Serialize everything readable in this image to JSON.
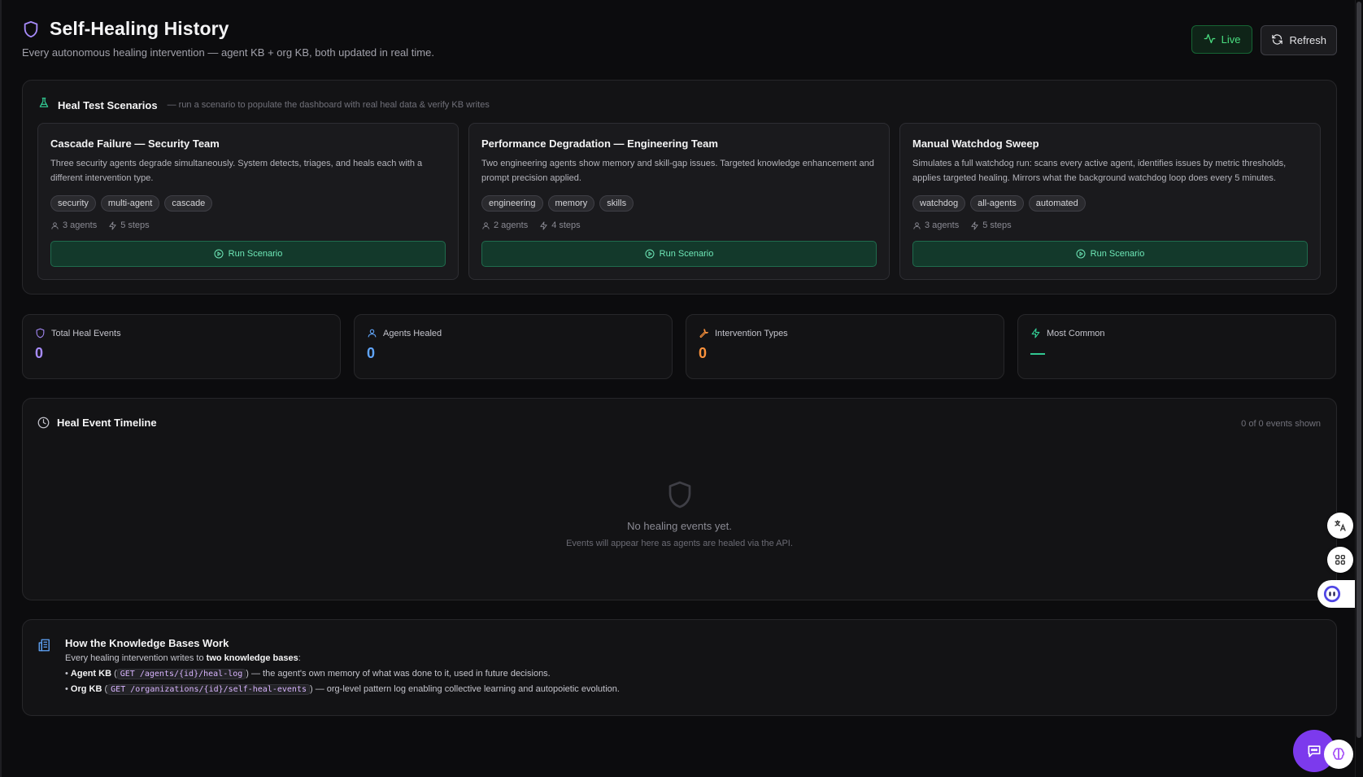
{
  "header": {
    "title": "Self-Healing History",
    "subtitle": "Every autonomous healing intervention — agent KB + org KB, both updated in real time.",
    "live_label": "Live",
    "refresh_label": "Refresh"
  },
  "scenarios": {
    "title": "Heal Test Scenarios",
    "hint": "— run a scenario to populate the dashboard with real heal data & verify KB writes",
    "cards": [
      {
        "title": "Cascade Failure — Security Team",
        "description": "Three security agents degrade simultaneously. System detects, triages, and heals each with a different intervention type.",
        "tags": [
          "security",
          "multi-agent",
          "cascade"
        ],
        "agents": "3 agents",
        "steps": "5 steps",
        "button": "Run Scenario"
      },
      {
        "title": "Performance Degradation — Engineering Team",
        "description": "Two engineering agents show memory and skill-gap issues. Targeted knowledge enhancement and prompt precision applied.",
        "tags": [
          "engineering",
          "memory",
          "skills"
        ],
        "agents": "2 agents",
        "steps": "4 steps",
        "button": "Run Scenario"
      },
      {
        "title": "Manual Watchdog Sweep",
        "description": "Simulates a full watchdog run: scans every active agent, identifies issues by metric thresholds, applies targeted healing. Mirrors what the background watchdog loop does every 5 minutes.",
        "tags": [
          "watchdog",
          "all-agents",
          "automated"
        ],
        "agents": "3 agents",
        "steps": "5 steps",
        "button": "Run Scenario"
      }
    ]
  },
  "stats": [
    {
      "label": "Total Heal Events",
      "value": "0",
      "color": "#a78bfa",
      "icon": "shield-icon"
    },
    {
      "label": "Agents Healed",
      "value": "0",
      "color": "#60a5fa",
      "icon": "user-icon"
    },
    {
      "label": "Intervention Types",
      "value": "0",
      "color": "#fb923c",
      "icon": "wrench-icon"
    },
    {
      "label": "Most Common",
      "value": "—",
      "color": "#34d399",
      "icon": "bolt-icon"
    }
  ],
  "timeline": {
    "title": "Heal Event Timeline",
    "count": "0 of 0 events shown",
    "empty_title": "No healing events yet.",
    "empty_sub": "Events will appear here as agents are healed via the API."
  },
  "kb": {
    "title": "How the Knowledge Bases Work",
    "intro_prefix": "Every healing intervention writes to ",
    "intro_bold": "two knowledge bases",
    "intro_suffix": ":",
    "agent_bullet": "• ",
    "agent_name": "Agent KB",
    "agent_open": " (",
    "agent_code": "GET /agents/{id}/heal-log",
    "agent_text": ") — the agent's own memory of what was done to it, used in future decisions.",
    "org_bullet": "• ",
    "org_name": "Org KB",
    "org_open": " (",
    "org_code": "GET /organizations/{id}/self-heal-events",
    "org_text": ") — org-level pattern log enabling collective learning and autopoietic evolution."
  },
  "colors": {
    "accent_purple": "#a78bfa",
    "live_green": "#4ade80",
    "run_green": "#6ee7b7",
    "chat_fab": "#7c3aed"
  }
}
